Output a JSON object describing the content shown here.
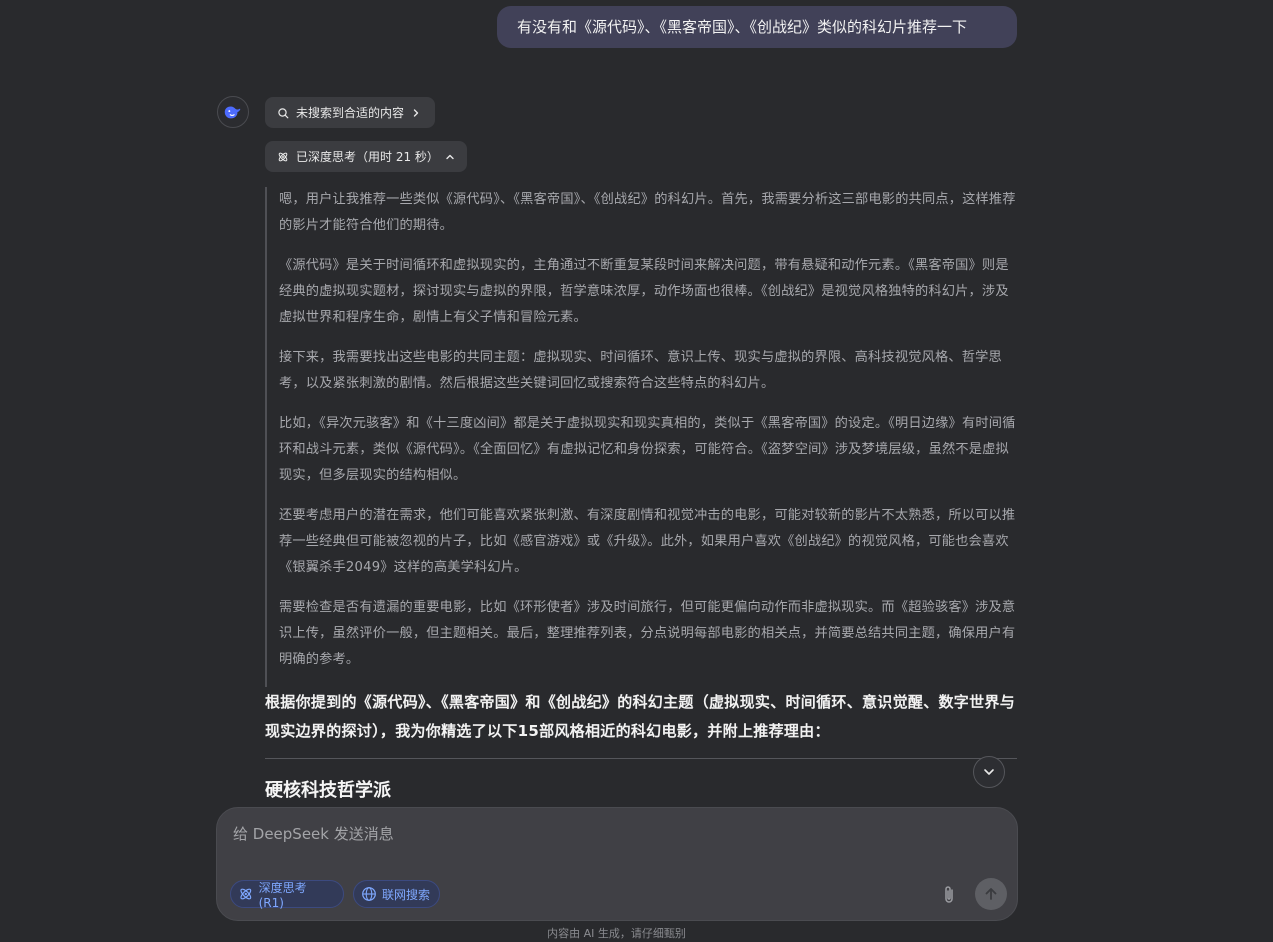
{
  "user_message": "有没有和《源代码》、《黑客帝国》、《创战纪》类似的科幻片推荐一下",
  "assistant": {
    "search_status": "未搜索到合适的内容",
    "think_status": "已深度思考（用时 21 秒）",
    "thinking_paragraphs": [
      "嗯，用户让我推荐一些类似《源代码》、《黑客帝国》、《创战纪》的科幻片。首先，我需要分析这三部电影的共同点，这样推荐的影片才能符合他们的期待。",
      "《源代码》是关于时间循环和虚拟现实的，主角通过不断重复某段时间来解决问题，带有悬疑和动作元素。《黑客帝国》则是经典的虚拟现实题材，探讨现实与虚拟的界限，哲学意味浓厚，动作场面也很棒。《创战纪》是视觉风格独特的科幻片，涉及虚拟世界和程序生命，剧情上有父子情和冒险元素。",
      "接下来，我需要找出这些电影的共同主题：虚拟现实、时间循环、意识上传、现实与虚拟的界限、高科技视觉风格、哲学思考，以及紧张刺激的剧情。然后根据这些关键词回忆或搜索符合这些特点的科幻片。",
      "比如，《异次元骇客》和《十三度凶间》都是关于虚拟现实和现实真相的，类似于《黑客帝国》的设定。《明日边缘》有时间循环和战斗元素，类似《源代码》。《全面回忆》有虚拟记忆和身份探索，可能符合。《盗梦空间》涉及梦境层级，虽然不是虚拟现实，但多层现实的结构相似。",
      "还要考虑用户的潜在需求，他们可能喜欢紧张刺激、有深度剧情和视觉冲击的电影，可能对较新的影片不太熟悉，所以可以推荐一些经典但可能被忽视的片子，比如《感官游戏》或《升级》。此外，如果用户喜欢《创战纪》的视觉风格，可能也会喜欢《银翼杀手2049》这样的高美学科幻片。",
      "需要检查是否有遗漏的重要电影，比如《环形使者》涉及时间旅行，但可能更偏向动作而非虚拟现实。而《超验骇客》涉及意识上传，虽然评价一般，但主题相关。最后，整理推荐列表，分点说明每部电影的相关点，并简要总结共同主题，确保用户有明确的参考。"
    ],
    "answer_intro": "根据你提到的《源代码》、《黑客帝国》和《创战纪》的科幻主题（虚拟现实、时间循环、意识觉醒、数字世界与现实边界的探讨），我为你精选了以下15部风格相近的科幻电影，并附上推荐理由：",
    "section_heading": "硬核科技哲学派"
  },
  "composer": {
    "placeholder": "给 DeepSeek 发送消息",
    "deep_think_label": "深度思考 (R1)",
    "web_search_label": "联网搜索"
  },
  "footer_note": "内容由 AI 生成，请仔细甄别",
  "colors": {
    "background": "#292a2d",
    "user_bubble": "#414158",
    "accent": "#7fa8ff",
    "brand_blue": "#4d6bfe"
  }
}
